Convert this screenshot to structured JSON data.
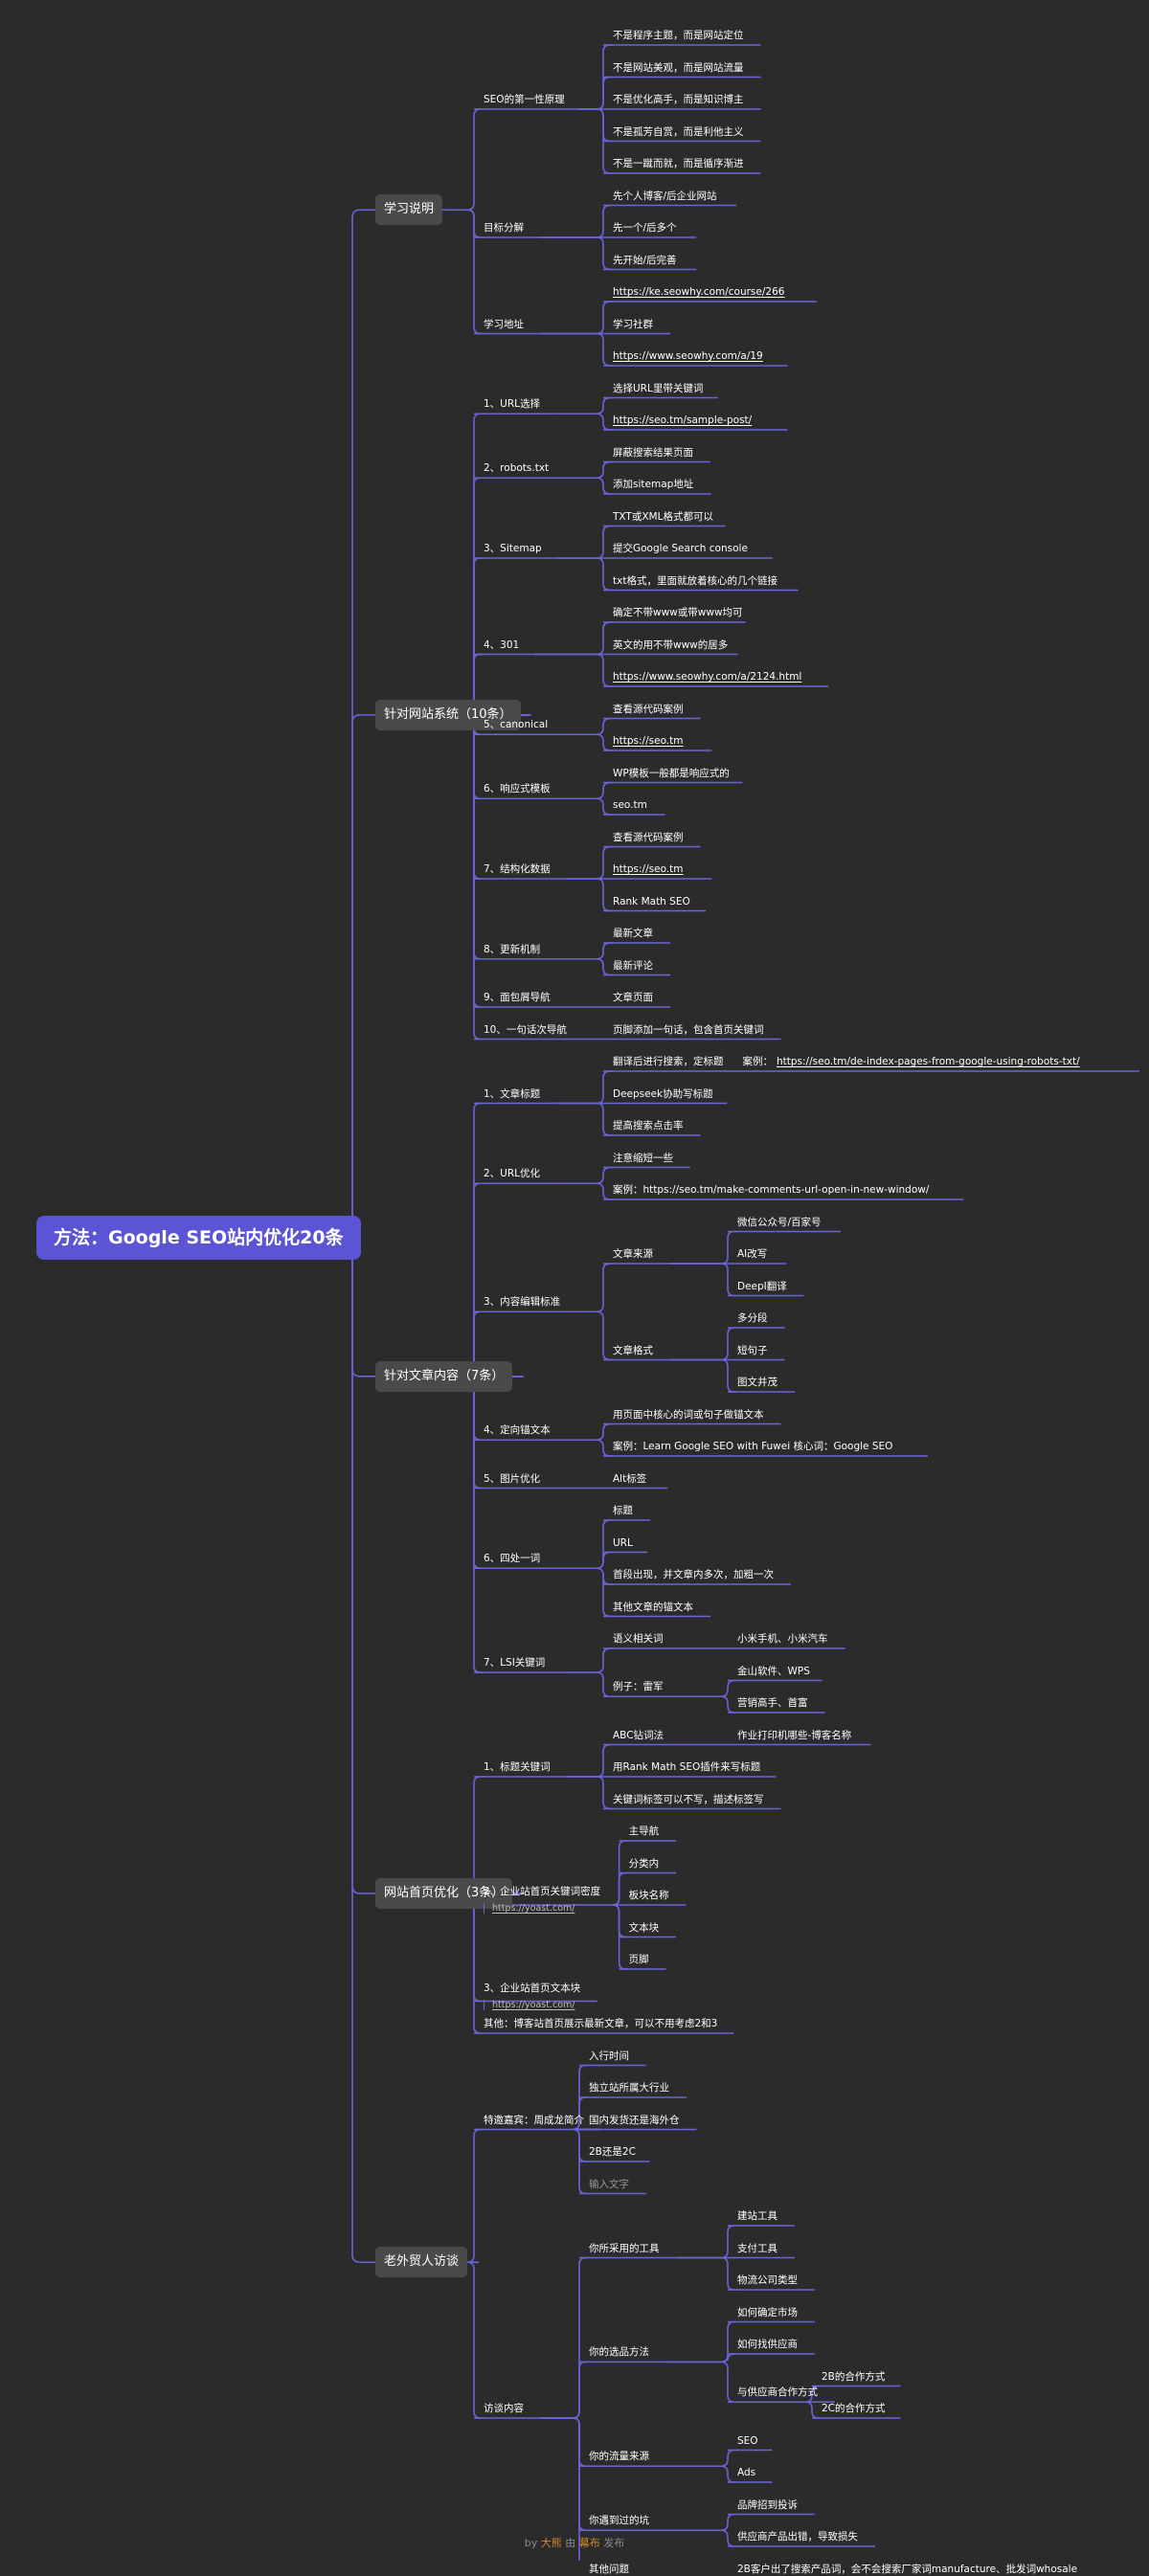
{
  "root": "方法：Google SEO站内优化20条",
  "accent_color": "#5b55d6",
  "line_color": "#6a64d8",
  "branches": [
    {
      "label": "学习说明",
      "children": [
        {
          "label": "SEO的第一性原理",
          "children": [
            {
              "label": "不是程序主题，而是网站定位"
            },
            {
              "label": "不是网站美观，而是网站流量"
            },
            {
              "label": "不是优化高手，而是知识博主"
            },
            {
              "label": "不是孤芳自赏，而是利他主义"
            },
            {
              "label": "不是一蹴而就，而是循序渐进"
            }
          ]
        },
        {
          "label": "目标分解",
          "children": [
            {
              "label": "先个人博客/后企业网站"
            },
            {
              "label": "先一个/后多个"
            },
            {
              "label": "先开始/后完善"
            }
          ]
        },
        {
          "label": "学习地址",
          "children": [
            {
              "label": "https://ke.seowhy.com/course/266",
              "url": true
            },
            {
              "label": "学习社群"
            },
            {
              "label": "https://www.seowhy.com/a/19",
              "url": true
            }
          ]
        }
      ]
    },
    {
      "label": "针对网站系统（10条）",
      "children": [
        {
          "label": "1、URL选择",
          "children": [
            {
              "label": "选择URL里带关键词"
            },
            {
              "label": "https://seo.tm/sample-post/",
              "url": true
            }
          ]
        },
        {
          "label": "2、robots.txt",
          "children": [
            {
              "label": "屏蔽搜索结果页面"
            },
            {
              "label": "添加sitemap地址"
            }
          ]
        },
        {
          "label": "3、Sitemap",
          "children": [
            {
              "label": "TXT或XML格式都可以"
            },
            {
              "label": "提交Google Search console"
            },
            {
              "label": "txt格式，里面就放着核心的几个链接"
            }
          ]
        },
        {
          "label": "4、301",
          "children": [
            {
              "label": "确定不带www或带www均可"
            },
            {
              "label": "英文的用不带www的居多"
            },
            {
              "label": "https://www.seowhy.com/a/2124.html",
              "url": true
            }
          ]
        },
        {
          "label": "5、canonical",
          "children": [
            {
              "label": "查看源代码案例"
            },
            {
              "label": "https://seo.tm",
              "url": true
            }
          ]
        },
        {
          "label": "6、响应式模板",
          "children": [
            {
              "label": "WP模板一般都是响应式的"
            },
            {
              "label": "seo.tm"
            }
          ]
        },
        {
          "label": "7、结构化数据",
          "children": [
            {
              "label": "查看源代码案例"
            },
            {
              "label": "https://seo.tm",
              "url": true
            },
            {
              "label": "Rank Math SEO"
            }
          ]
        },
        {
          "label": "8、更新机制",
          "children": [
            {
              "label": "最新文章"
            },
            {
              "label": "最新评论"
            }
          ]
        },
        {
          "label": "9、面包屑导航",
          "children": [
            {
              "label": "文章页面"
            }
          ]
        },
        {
          "label": "10、一句话次导航",
          "children": [
            {
              "label": "页脚添加一句话，包含首页关键词"
            }
          ]
        }
      ]
    },
    {
      "label": "针对文章内容（7条）",
      "children": [
        {
          "label": "1、文章标题",
          "children": [
            {
              "label": "翻译后进行搜索，定标题",
              "ex": "案例：",
              "ex2": "https://seo.tm/de-index-pages-from-google-using-robots-txt/"
            },
            {
              "label": "Deepseek协助写标题"
            },
            {
              "label": "提高搜索点击率"
            }
          ]
        },
        {
          "label": "2、URL优化",
          "children": [
            {
              "label": "注意缩短一些"
            },
            {
              "label": "案例：https://seo.tm/make-comments-url-open-in-new-window/"
            }
          ]
        },
        {
          "label": "3、内容编辑标准",
          "children": [
            {
              "label": "文章来源",
              "children": [
                {
                  "label": "微信公众号/百家号"
                },
                {
                  "label": "AI改写"
                },
                {
                  "label": "DeepI翻译"
                }
              ]
            },
            {
              "label": "文章格式",
              "children": [
                {
                  "label": "多分段"
                },
                {
                  "label": "短句子"
                },
                {
                  "label": "图文并茂"
                }
              ]
            }
          ]
        },
        {
          "label": "4、定向锚文本",
          "children": [
            {
              "label": "用页面中核心的词或句子做锚文本"
            },
            {
              "label": "案例：Learn Google SEO with Fuwei  核心词：Google SEO"
            }
          ]
        },
        {
          "label": "5、图片优化",
          "children": [
            {
              "label": "Alt标签"
            }
          ]
        },
        {
          "label": "6、四处一词",
          "children": [
            {
              "label": "标题"
            },
            {
              "label": "URL"
            },
            {
              "label": "首段出现，并文章内多次，加粗一次"
            },
            {
              "label": "其他文章的锚文本"
            }
          ]
        },
        {
          "label": "7、LSI关键词",
          "children": [
            {
              "label": "语义相关词",
              "children": [
                {
                  "label": "小米手机、小米汽车"
                }
              ]
            },
            {
              "label": "例子：雷军",
              "children": [
                {
                  "label": "金山软件、WPS"
                },
                {
                  "label": "营销高手、首富"
                }
              ]
            }
          ]
        }
      ]
    },
    {
      "label": "网站首页优化（3条）",
      "children": [
        {
          "label": "1、标题关键词",
          "children": [
            {
              "label": "ABC钻词法",
              "children": [
                {
                  "label": "作业打印机哪些-博客名称"
                }
              ]
            },
            {
              "label": "用Rank Math SEO插件来写标题"
            },
            {
              "label": "关键词标签可以不写，描述标签写"
            }
          ]
        },
        {
          "label": "2、企业站首页关键词密度",
          "sub": "https://yoast.com/",
          "children": [
            {
              "label": "主导航"
            },
            {
              "label": "分类内"
            },
            {
              "label": "板块名称"
            },
            {
              "label": "文本块"
            },
            {
              "label": "页脚"
            }
          ]
        },
        {
          "label": "3、企业站首页文本块",
          "sub": "https://yoast.com/"
        },
        {
          "label": "其他：博客站首页展示最新文章，可以不用考虑2和3"
        }
      ]
    },
    {
      "label": "老外贸人访谈",
      "children": [
        {
          "label": "特邀嘉宾：周成龙简介",
          "children": [
            {
              "label": "入行时间"
            },
            {
              "label": "独立站所属大行业"
            },
            {
              "label": "国内发货还是海外仓"
            },
            {
              "label": "2B还是2C"
            },
            {
              "label": "输入文字",
              "muted": true
            }
          ]
        },
        {
          "label": "访谈内容",
          "children": [
            {
              "label": "你所采用的工具",
              "children": [
                {
                  "label": "建站工具"
                },
                {
                  "label": "支付工具"
                },
                {
                  "label": "物流公司类型"
                }
              ]
            },
            {
              "label": "你的选品方法",
              "children": [
                {
                  "label": "如何确定市场"
                },
                {
                  "label": "如何找供应商"
                },
                {
                  "label": "与供应商合作方式",
                  "children": [
                    {
                      "label": "2B的合作方式"
                    },
                    {
                      "label": "2C的合作方式"
                    }
                  ]
                }
              ]
            },
            {
              "label": "你的流量来源",
              "children": [
                {
                  "label": "SEO"
                },
                {
                  "label": "Ads"
                }
              ]
            },
            {
              "label": "你遇到过的坑",
              "children": [
                {
                  "label": "品牌招到投诉"
                },
                {
                  "label": "供应商产品出错，导致损失"
                }
              ]
            },
            {
              "label": "其他问题",
              "children": [
                {
                  "label": "2B客户出了搜索产品词，会不会搜索厂家词manufacture、批发词whosale"
                }
              ]
            }
          ]
        }
      ]
    }
  ],
  "footer": {
    "by": "by",
    "author": "大熊",
    "made": "由",
    "tool": "幕布",
    "publish": "发布"
  }
}
